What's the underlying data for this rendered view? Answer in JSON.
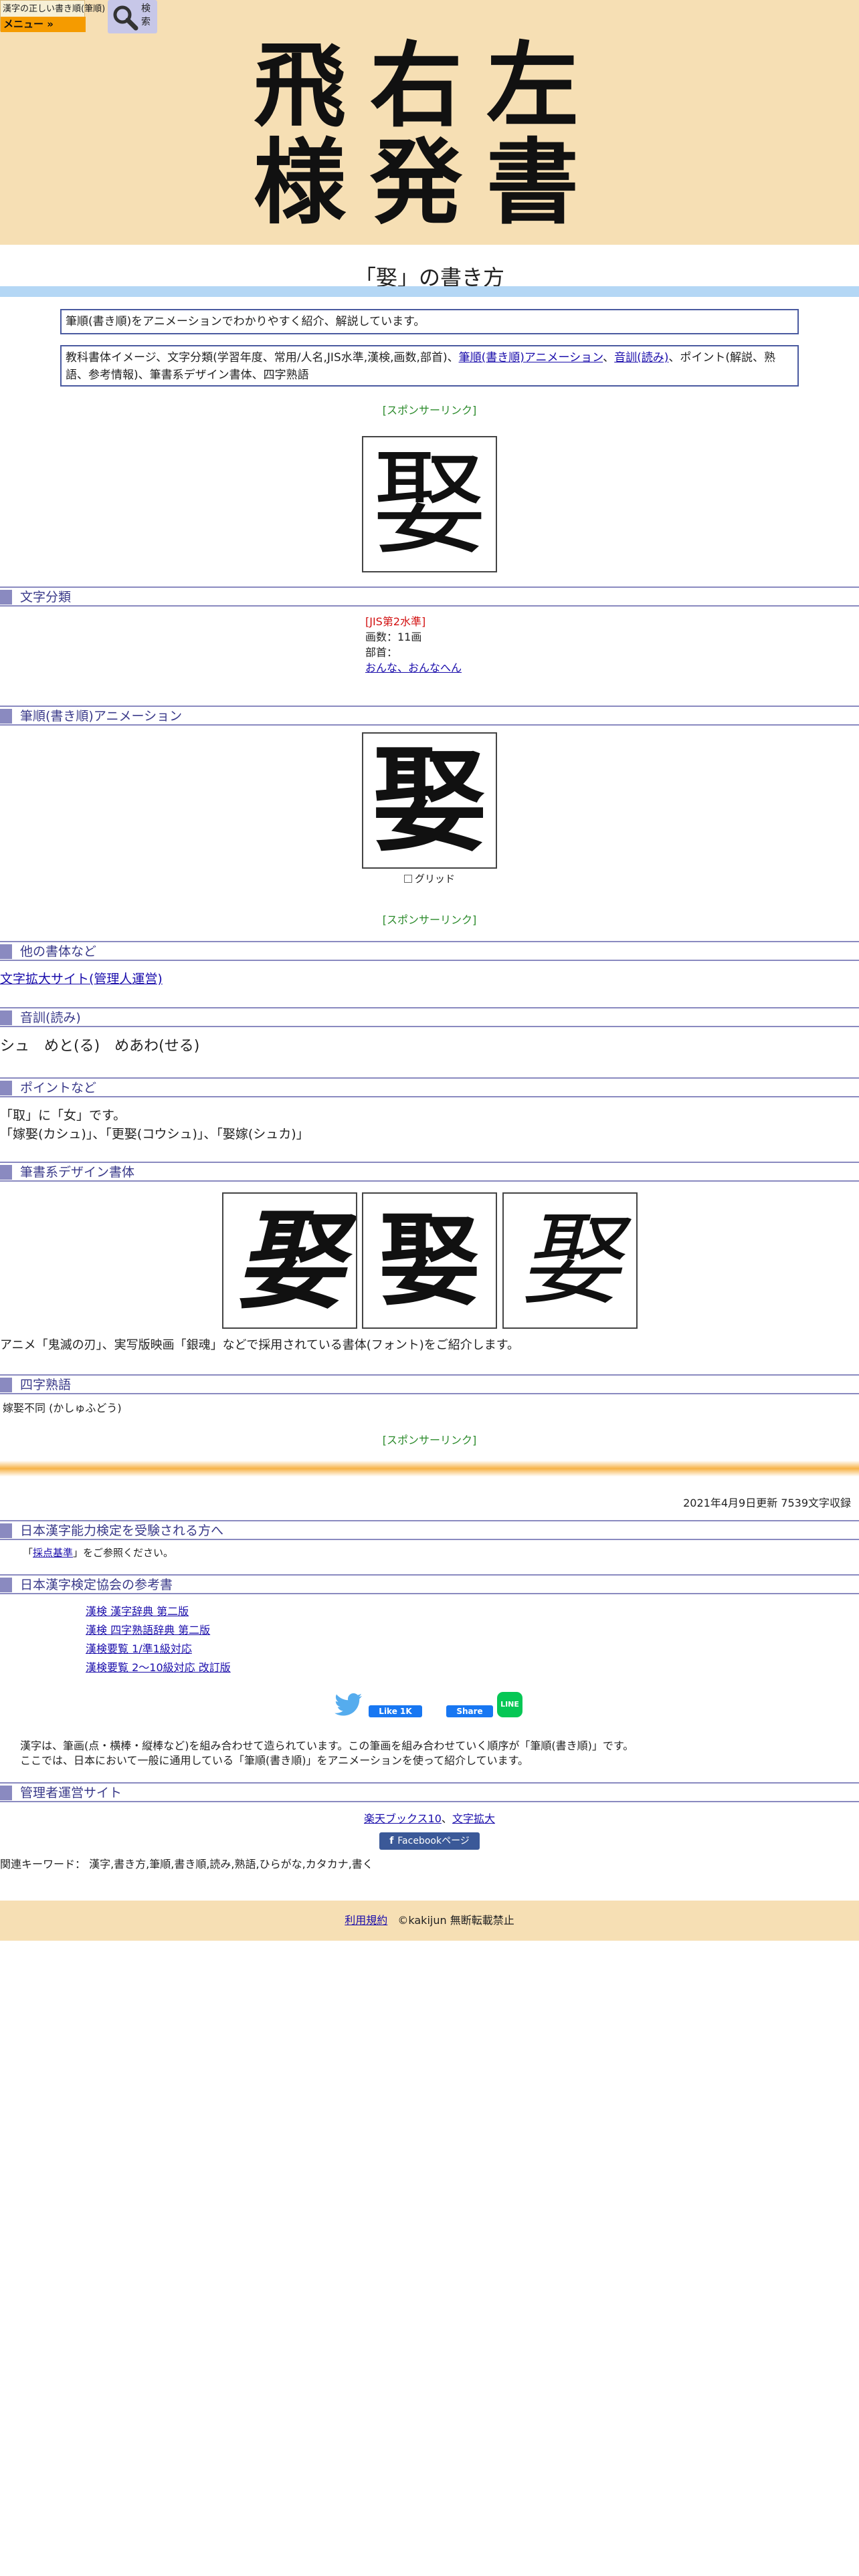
{
  "header": {
    "logo_title": "漢字の正しい書き順(筆順)",
    "menu_label": "メニュー »",
    "search_label": "検索",
    "banner_line1": "飛右左",
    "banner_line2": "様発書"
  },
  "page": {
    "title": "「娶」の書き方",
    "intro": "筆順(書き順)をアニメーションでわかりやすく紹介、解説しています。",
    "features_prefix": "教科書体イメージ、文字分類(学習年度、常用/人名,JIS水準,漢検,画数,部首)、",
    "features_link1": "筆順(書き順)アニメーション",
    "features_sep": "、",
    "features_link2": "音訓(読み)",
    "features_suffix": "、ポイント(解説、熟語、参考情報)、筆書系デザイン書体、四字熟語",
    "sponsor": "[スポンサーリンク]",
    "kanji": "娶"
  },
  "sections": {
    "classification": "文字分類",
    "animation": "筆順(書き順)アニメーション",
    "other_fonts": "他の書体など",
    "readings": "音訓(読み)",
    "points": "ポイントなど",
    "brush_fonts": "筆書系デザイン書体",
    "yoji": "四字熟語"
  },
  "classification": {
    "jis": "[JIS第2水準]",
    "strokes": "画数：11画",
    "radical_label": "部首：",
    "radical_link": "おんな、おんなへん"
  },
  "animation": {
    "grid_label": "グリッド"
  },
  "other_fonts": {
    "link": "文字拡大サイト(管理人運営)"
  },
  "readings": {
    "text": "シュ　めと(る)　めあわ(せる)"
  },
  "points": {
    "line1": "「取」に「女」です。",
    "line2": "「嫁娶(カシュ)」、「更娶(コウシュ)」、「娶嫁(シュカ)」"
  },
  "brush_fonts": {
    "caption": "アニメ「鬼滅の刃」、実写版映画「銀魂」などで採用されている書体(フォント)をご紹介します。"
  },
  "yoji": {
    "text": "嫁娶不同 (かしゅふどう)"
  },
  "meta": {
    "updated": "2021年4月9日更新 7539文字収録"
  },
  "kentei": {
    "heading": "日本漢字能力検定を受験される方へ",
    "prefix": "「",
    "link": "採点基準",
    "suffix": "」をご参照ください。"
  },
  "books": {
    "heading": "日本漢字検定協会の参考書",
    "items": [
      "漢検 漢字辞典 第二版",
      "漢検 四字熟語辞典 第二版",
      "漢検要覧 1/準1級対応",
      "漢検要覧 2～10級対応 改訂版"
    ]
  },
  "social": {
    "like": "Like 1K",
    "share": "Share",
    "line": "LINE"
  },
  "description": {
    "line1": "漢字は、筆画(点・横棒・縦棒など)を組み合わせて造られています。この筆画を組み合わせていく順序が「筆順(書き順)」です。",
    "line2": "ここでは、日本において一般に通用している「筆順(書き順)」をアニメーションを使って紹介しています。"
  },
  "admin": {
    "heading": "管理者運営サイト",
    "link1": "楽天ブックス10",
    "sep": "、",
    "link2": "文字拡大",
    "fb_page": "Facebookページ"
  },
  "keywords": {
    "text": "関連キーワード： 漢字,書き方,筆順,書き順,読み,熟語,ひらがな,カタカナ,書く"
  },
  "footer": {
    "terms": "利用規約",
    "copyright": "©kakijun 無断転載禁止"
  },
  "colors": {
    "header_bg": "#f6dfb4",
    "title_bar": "#b4d7f5",
    "section_accent": "#8a8ac0",
    "sponsor_green": "#2a8a2a",
    "jis_red": "#d21010",
    "menu_orange": "#f59b00"
  }
}
